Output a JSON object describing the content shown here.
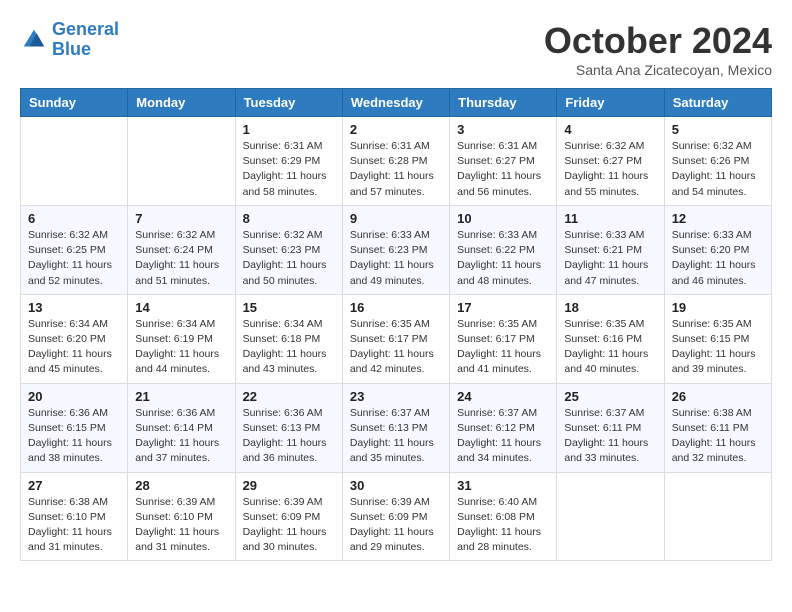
{
  "header": {
    "logo_line1": "General",
    "logo_line2": "Blue",
    "month_title": "October 2024",
    "subtitle": "Santa Ana Zicatecoyan, Mexico"
  },
  "weekdays": [
    "Sunday",
    "Monday",
    "Tuesday",
    "Wednesday",
    "Thursday",
    "Friday",
    "Saturday"
  ],
  "weeks": [
    [
      null,
      null,
      {
        "day": "1",
        "sunrise": "6:31 AM",
        "sunset": "6:29 PM",
        "daylight": "11 hours and 58 minutes."
      },
      {
        "day": "2",
        "sunrise": "6:31 AM",
        "sunset": "6:28 PM",
        "daylight": "11 hours and 57 minutes."
      },
      {
        "day": "3",
        "sunrise": "6:31 AM",
        "sunset": "6:27 PM",
        "daylight": "11 hours and 56 minutes."
      },
      {
        "day": "4",
        "sunrise": "6:32 AM",
        "sunset": "6:27 PM",
        "daylight": "11 hours and 55 minutes."
      },
      {
        "day": "5",
        "sunrise": "6:32 AM",
        "sunset": "6:26 PM",
        "daylight": "11 hours and 54 minutes."
      }
    ],
    [
      {
        "day": "6",
        "sunrise": "6:32 AM",
        "sunset": "6:25 PM",
        "daylight": "11 hours and 52 minutes."
      },
      {
        "day": "7",
        "sunrise": "6:32 AM",
        "sunset": "6:24 PM",
        "daylight": "11 hours and 51 minutes."
      },
      {
        "day": "8",
        "sunrise": "6:32 AM",
        "sunset": "6:23 PM",
        "daylight": "11 hours and 50 minutes."
      },
      {
        "day": "9",
        "sunrise": "6:33 AM",
        "sunset": "6:23 PM",
        "daylight": "11 hours and 49 minutes."
      },
      {
        "day": "10",
        "sunrise": "6:33 AM",
        "sunset": "6:22 PM",
        "daylight": "11 hours and 48 minutes."
      },
      {
        "day": "11",
        "sunrise": "6:33 AM",
        "sunset": "6:21 PM",
        "daylight": "11 hours and 47 minutes."
      },
      {
        "day": "12",
        "sunrise": "6:33 AM",
        "sunset": "6:20 PM",
        "daylight": "11 hours and 46 minutes."
      }
    ],
    [
      {
        "day": "13",
        "sunrise": "6:34 AM",
        "sunset": "6:20 PM",
        "daylight": "11 hours and 45 minutes."
      },
      {
        "day": "14",
        "sunrise": "6:34 AM",
        "sunset": "6:19 PM",
        "daylight": "11 hours and 44 minutes."
      },
      {
        "day": "15",
        "sunrise": "6:34 AM",
        "sunset": "6:18 PM",
        "daylight": "11 hours and 43 minutes."
      },
      {
        "day": "16",
        "sunrise": "6:35 AM",
        "sunset": "6:17 PM",
        "daylight": "11 hours and 42 minutes."
      },
      {
        "day": "17",
        "sunrise": "6:35 AM",
        "sunset": "6:17 PM",
        "daylight": "11 hours and 41 minutes."
      },
      {
        "day": "18",
        "sunrise": "6:35 AM",
        "sunset": "6:16 PM",
        "daylight": "11 hours and 40 minutes."
      },
      {
        "day": "19",
        "sunrise": "6:35 AM",
        "sunset": "6:15 PM",
        "daylight": "11 hours and 39 minutes."
      }
    ],
    [
      {
        "day": "20",
        "sunrise": "6:36 AM",
        "sunset": "6:15 PM",
        "daylight": "11 hours and 38 minutes."
      },
      {
        "day": "21",
        "sunrise": "6:36 AM",
        "sunset": "6:14 PM",
        "daylight": "11 hours and 37 minutes."
      },
      {
        "day": "22",
        "sunrise": "6:36 AM",
        "sunset": "6:13 PM",
        "daylight": "11 hours and 36 minutes."
      },
      {
        "day": "23",
        "sunrise": "6:37 AM",
        "sunset": "6:13 PM",
        "daylight": "11 hours and 35 minutes."
      },
      {
        "day": "24",
        "sunrise": "6:37 AM",
        "sunset": "6:12 PM",
        "daylight": "11 hours and 34 minutes."
      },
      {
        "day": "25",
        "sunrise": "6:37 AM",
        "sunset": "6:11 PM",
        "daylight": "11 hours and 33 minutes."
      },
      {
        "day": "26",
        "sunrise": "6:38 AM",
        "sunset": "6:11 PM",
        "daylight": "11 hours and 32 minutes."
      }
    ],
    [
      {
        "day": "27",
        "sunrise": "6:38 AM",
        "sunset": "6:10 PM",
        "daylight": "11 hours and 31 minutes."
      },
      {
        "day": "28",
        "sunrise": "6:39 AM",
        "sunset": "6:10 PM",
        "daylight": "11 hours and 31 minutes."
      },
      {
        "day": "29",
        "sunrise": "6:39 AM",
        "sunset": "6:09 PM",
        "daylight": "11 hours and 30 minutes."
      },
      {
        "day": "30",
        "sunrise": "6:39 AM",
        "sunset": "6:09 PM",
        "daylight": "11 hours and 29 minutes."
      },
      {
        "day": "31",
        "sunrise": "6:40 AM",
        "sunset": "6:08 PM",
        "daylight": "11 hours and 28 minutes."
      },
      null,
      null
    ]
  ]
}
